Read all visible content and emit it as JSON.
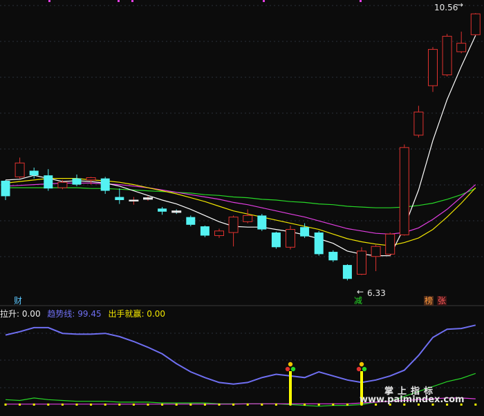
{
  "main_panel": {
    "high_label": "10.56",
    "low_label": "6.33",
    "left_tag": "财",
    "mid_tag": "减",
    "right_tag_1": "榜",
    "right_tag_2": "张"
  },
  "indicator_panel": {
    "legend": [
      {
        "label": "拉升: 0.00",
        "color": "#f0f0f0"
      },
      {
        "label": "趋势线: 99.45",
        "color": "#6f6ff2"
      },
      {
        "label": "出手就赢: 0.00",
        "color": "#f2e600"
      }
    ]
  },
  "watermark": {
    "cn": "掌上指标",
    "en": "www.palmindex.com"
  },
  "colors": {
    "up": "#e0322f",
    "down": "#54f2f2",
    "ma5": "#ffffff",
    "ma10": "#f2e600",
    "ma20": "#e23ee2",
    "ma60": "#27d827",
    "trend": "#6f6ff2",
    "signal": "#ffff00"
  },
  "chart_data": {
    "type": "candlestick",
    "candles": [
      {
        "o": 8.55,
        "c": 8.35,
        "h": 8.56,
        "l": 8.3
      },
      {
        "o": 8.6,
        "c": 8.78,
        "h": 8.85,
        "l": 8.58
      },
      {
        "o": 8.68,
        "c": 8.62,
        "h": 8.72,
        "l": 8.58
      },
      {
        "o": 8.62,
        "c": 8.45,
        "h": 8.7,
        "l": 8.42
      },
      {
        "o": 8.46,
        "c": 8.53,
        "h": 8.56,
        "l": 8.44
      },
      {
        "o": 8.58,
        "c": 8.5,
        "h": 8.63,
        "l": 8.48
      },
      {
        "o": 8.56,
        "c": 8.59,
        "h": 8.6,
        "l": 8.5
      },
      {
        "o": 8.58,
        "c": 8.42,
        "h": 8.6,
        "l": 8.38
      },
      {
        "o": 8.34,
        "c": 8.3,
        "h": 8.45,
        "l": 8.25
      },
      {
        "o": 8.3,
        "c": 8.3,
        "h": 8.34,
        "l": 8.24
      },
      {
        "o": 8.31,
        "c": 8.33,
        "h": 8.35,
        "l": 8.29
      },
      {
        "o": 8.19,
        "c": 8.15,
        "h": 8.21,
        "l": 8.11
      },
      {
        "o": 8.16,
        "c": 8.14,
        "h": 8.18,
        "l": 8.12
      },
      {
        "o": 8.08,
        "c": 7.98,
        "h": 8.1,
        "l": 7.96
      },
      {
        "o": 7.96,
        "c": 7.84,
        "h": 7.97,
        "l": 7.82
      },
      {
        "o": 7.84,
        "c": 7.9,
        "h": 7.93,
        "l": 7.81
      },
      {
        "o": 7.88,
        "c": 8.08,
        "h": 8.1,
        "l": 7.7
      },
      {
        "o": 8.02,
        "c": 8.1,
        "h": 8.18,
        "l": 8.0
      },
      {
        "o": 8.1,
        "c": 7.92,
        "h": 8.12,
        "l": 7.9
      },
      {
        "o": 7.88,
        "c": 7.69,
        "h": 7.89,
        "l": 7.67
      },
      {
        "o": 7.69,
        "c": 7.92,
        "h": 7.97,
        "l": 7.66
      },
      {
        "o": 7.95,
        "c": 7.83,
        "h": 8.0,
        "l": 7.81
      },
      {
        "o": 7.88,
        "c": 7.6,
        "h": 7.9,
        "l": 7.58
      },
      {
        "o": 7.63,
        "c": 7.52,
        "h": 7.65,
        "l": 7.5
      },
      {
        "o": 7.46,
        "c": 7.28,
        "h": 7.47,
        "l": 7.26
      },
      {
        "o": 7.34,
        "c": 7.64,
        "h": 7.69,
        "l": 7.33
      },
      {
        "o": 7.57,
        "c": 7.7,
        "h": 7.72,
        "l": 7.38
      },
      {
        "o": 7.6,
        "c": 7.86,
        "h": 7.88,
        "l": 7.58
      },
      {
        "o": 7.85,
        "c": 8.98,
        "h": 9.02,
        "l": 7.84
      },
      {
        "o": 9.14,
        "c": 9.44,
        "h": 9.52,
        "l": 9.11
      },
      {
        "o": 9.78,
        "c": 10.25,
        "h": 10.28,
        "l": 9.7
      },
      {
        "o": 9.92,
        "c": 10.42,
        "h": 10.45,
        "l": 9.9
      },
      {
        "o": 10.22,
        "c": 10.33,
        "h": 10.48,
        "l": 10.2
      },
      {
        "o": 10.44,
        "c": 10.71,
        "h": 10.72,
        "l": 10.43
      }
    ],
    "ma5": [
      8.56,
      8.57,
      8.62,
      8.58,
      8.54,
      8.55,
      8.54,
      8.52,
      8.48,
      8.42,
      8.36,
      8.3,
      8.25,
      8.18,
      8.1,
      8.02,
      7.96,
      7.95,
      7.95,
      7.92,
      7.89,
      7.85,
      7.8,
      7.74,
      7.64,
      7.6,
      7.58,
      7.58,
      7.95,
      8.43,
      9.07,
      9.6,
      10.03,
      10.43
    ],
    "ma10": [
      8.52,
      8.54,
      8.56,
      8.58,
      8.58,
      8.58,
      8.56,
      8.55,
      8.53,
      8.5,
      8.46,
      8.42,
      8.38,
      8.33,
      8.28,
      8.22,
      8.16,
      8.12,
      8.08,
      8.04,
      8.0,
      7.96,
      7.92,
      7.86,
      7.8,
      7.76,
      7.73,
      7.71,
      7.75,
      7.81,
      7.92,
      8.08,
      8.26,
      8.46
    ],
    "ma20": [
      8.48,
      8.49,
      8.5,
      8.51,
      8.52,
      8.52,
      8.52,
      8.51,
      8.5,
      8.48,
      8.46,
      8.43,
      8.4,
      8.37,
      8.34,
      8.31,
      8.27,
      8.24,
      8.2,
      8.16,
      8.12,
      8.08,
      8.03,
      7.98,
      7.93,
      7.9,
      7.87,
      7.86,
      7.88,
      7.94,
      8.05,
      8.18,
      8.34,
      8.5
    ],
    "ma60": [
      8.46,
      8.46,
      8.46,
      8.46,
      8.46,
      8.46,
      8.45,
      8.45,
      8.44,
      8.43,
      8.42,
      8.41,
      8.4,
      8.39,
      8.37,
      8.36,
      8.34,
      8.33,
      8.31,
      8.3,
      8.28,
      8.27,
      8.25,
      8.24,
      8.22,
      8.21,
      8.2,
      8.2,
      8.21,
      8.23,
      8.26,
      8.31,
      8.37,
      8.45
    ],
    "trend": [
      85,
      89,
      94,
      94,
      87,
      86,
      86,
      87,
      83,
      77,
      70,
      62,
      50,
      40,
      33,
      27,
      25,
      27,
      33,
      37,
      35,
      33,
      40,
      35,
      30,
      27,
      30,
      35,
      42,
      60,
      82,
      92,
      93,
      97
    ],
    "green_line": [
      6,
      5,
      8,
      6,
      5,
      4,
      4,
      4,
      3,
      3,
      3,
      2,
      2,
      2,
      2,
      1,
      1,
      1,
      1,
      1,
      0,
      -1,
      -2,
      -1,
      -1,
      0,
      3,
      4,
      10,
      16,
      22,
      28,
      32,
      38
    ],
    "magenta_line": [
      0.5,
      0.5,
      0.5,
      0.5,
      0.5,
      0.5,
      0.5,
      0.5,
      0.5,
      0.5,
      0.5,
      0.5,
      0.5,
      0.5,
      0.5,
      0.5,
      0.5,
      1,
      1,
      1,
      1,
      1,
      1,
      1,
      1,
      2,
      3,
      4,
      5,
      6,
      7,
      8,
      8,
      7
    ],
    "signals": [
      {
        "index": 20
      },
      {
        "index": 25
      }
    ],
    "main_ylim": [
      7.05,
      10.8
    ],
    "indicator_ylim": [
      -3,
      104
    ]
  }
}
